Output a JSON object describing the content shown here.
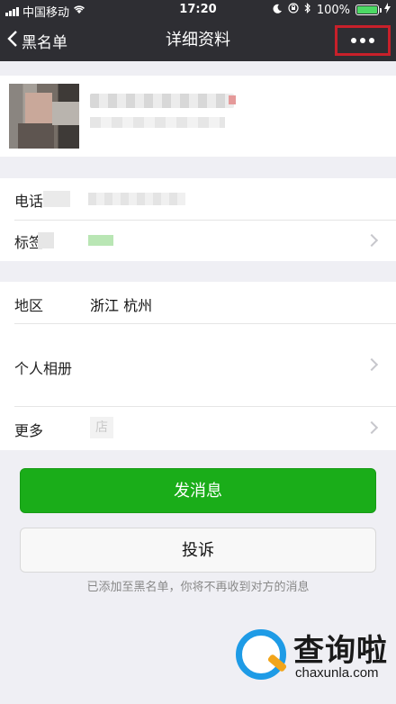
{
  "status_bar": {
    "carrier": "中国移动",
    "time": "17:20",
    "battery": "100%"
  },
  "nav": {
    "back_label": "黑名单",
    "title": "详细资料"
  },
  "info_rows": [
    {
      "label": "电话"
    },
    {
      "label": "标签"
    }
  ],
  "details": {
    "region_label": "地区",
    "region_value": "浙江 杭州",
    "album_label": "个人相册",
    "more_label": "更多",
    "more_icon_text": "店"
  },
  "actions": {
    "send_label": "发消息",
    "report_label": "投诉",
    "blacklist_note": "已添加至黑名单，你将不再收到对方的消息"
  },
  "watermark": {
    "cn": "查询啦",
    "en": "chaxunla.com"
  },
  "colors": {
    "nav_bg": "#2e2e33",
    "primary_green": "#1aad19",
    "highlight_red": "#c8202a"
  }
}
